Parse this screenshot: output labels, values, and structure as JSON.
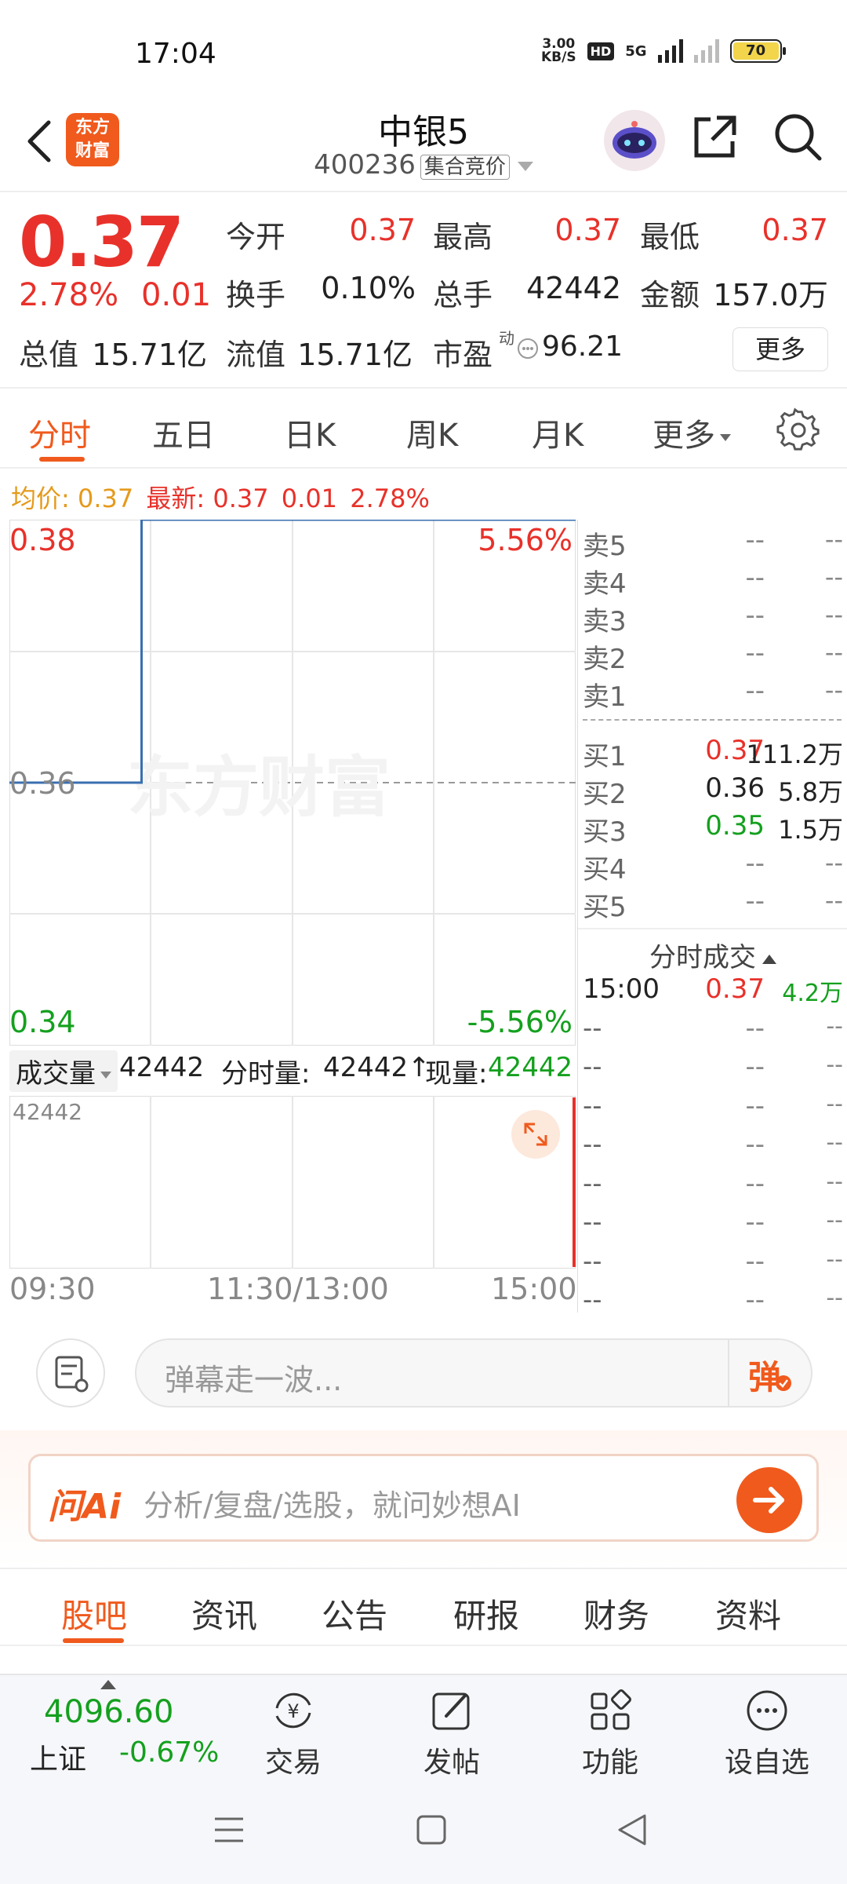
{
  "status_bar": {
    "time": "17:04",
    "net_speed_value": "3.00",
    "net_speed_unit": "KB/S",
    "hd_badge": "HD",
    "network": "5G",
    "battery": "70"
  },
  "header": {
    "logo_line1": "东方",
    "logo_line2": "财富",
    "stock_name": "中银5",
    "stock_code": "400236",
    "auction_tag": "集合竞价"
  },
  "quote": {
    "price": "0.37",
    "change_pct": "2.78%",
    "change_amt": "0.01",
    "open_label": "今开",
    "open": "0.37",
    "high_label": "最高",
    "high": "0.37",
    "low_label": "最低",
    "low": "0.37",
    "turnover_label": "换手",
    "turnover": "0.10%",
    "volume_label": "总手",
    "volume": "42442",
    "amount_label": "金额",
    "amount": "157.0万",
    "mktcap_label": "总值",
    "mktcap": "15.71亿",
    "float_label": "流值",
    "float_cap": "15.71亿",
    "pe_label": "市盈",
    "pe_sup": "动",
    "pe": "96.21",
    "more_button": "更多"
  },
  "chart_tabs": {
    "items": [
      "分时",
      "五日",
      "日K",
      "周K",
      "月K",
      "更多"
    ],
    "active": "分时"
  },
  "info_line": {
    "avg_label": "均价:",
    "avg": "0.37",
    "latest_label": "最新:",
    "latest": "0.37",
    "chg": "0.01",
    "pct": "2.78%"
  },
  "chart": {
    "y_top": "0.38",
    "y_mid": "0.36",
    "y_bottom": "0.34",
    "pct_top": "5.56%",
    "pct_bottom": "-5.56%",
    "watermark": "东方财富",
    "x_start": "09:30",
    "x_mid": "11:30/13:00",
    "x_end": "15:00",
    "vol_axis_max": "42442"
  },
  "chart_data": {
    "type": "line",
    "series": [
      {
        "values": [
          0.36,
          0.36,
          0.38,
          0.38,
          0.38
        ]
      }
    ],
    "x": [
      "09:30",
      "10:25",
      "10:26",
      "13:00",
      "15:00"
    ],
    "ylim": [
      0.34,
      0.38
    ],
    "ylabel": "",
    "xlabel": "",
    "title": ""
  },
  "volume_header": {
    "dropdown": "成交量",
    "total": "42442",
    "fenshi_label": "分时量:",
    "fenshi_value": "42442↑",
    "now_label": "现量:",
    "now_value": "42442"
  },
  "orderbook": {
    "asks": [
      {
        "label": "卖5",
        "price": "--",
        "vol": "--"
      },
      {
        "label": "卖4",
        "price": "--",
        "vol": "--"
      },
      {
        "label": "卖3",
        "price": "--",
        "vol": "--"
      },
      {
        "label": "卖2",
        "price": "--",
        "vol": "--"
      },
      {
        "label": "卖1",
        "price": "--",
        "vol": "--"
      }
    ],
    "bids": [
      {
        "label": "买1",
        "price": "0.37",
        "vol": "111.2万",
        "color": "#e8312a"
      },
      {
        "label": "买2",
        "price": "0.36",
        "vol": "5.8万",
        "color": "#222222"
      },
      {
        "label": "买3",
        "price": "0.35",
        "vol": "1.5万",
        "color": "#14a01e"
      },
      {
        "label": "买4",
        "price": "--",
        "vol": "--",
        "color": "#888888"
      },
      {
        "label": "买5",
        "price": "--",
        "vol": "--",
        "color": "#888888"
      }
    ],
    "trades_title": "分时成交",
    "trades": [
      {
        "time": "15:00",
        "price": "0.37",
        "vol": "4.2万"
      },
      {
        "time": "--",
        "price": "--",
        "vol": "--"
      },
      {
        "time": "--",
        "price": "--",
        "vol": "--"
      },
      {
        "time": "--",
        "price": "--",
        "vol": "--"
      },
      {
        "time": "--",
        "price": "--",
        "vol": "--"
      },
      {
        "time": "--",
        "price": "--",
        "vol": "--"
      },
      {
        "time": "--",
        "price": "--",
        "vol": "--"
      },
      {
        "time": "--",
        "price": "--",
        "vol": "--"
      },
      {
        "time": "--",
        "price": "--",
        "vol": "--"
      }
    ]
  },
  "comment_bar": {
    "placeholder": "弹幕走一波...",
    "danmu_label": "弹"
  },
  "ai_bar": {
    "logo": "问Ai",
    "placeholder": "分析/复盘/选股，就问妙想AI"
  },
  "section_tabs": {
    "items": [
      "股吧",
      "资讯",
      "公告",
      "研报",
      "财务",
      "资料"
    ],
    "active": "股吧"
  },
  "bottom_nav": {
    "index_value": "4096.60",
    "index_name": "上证",
    "index_change": "-0.67%",
    "items": [
      "交易",
      "发帖",
      "功能",
      "设自选"
    ]
  },
  "colors": {
    "up": "#e8312a",
    "down": "#14a01e",
    "accent": "#f05a1d",
    "line": "#3a6fb0",
    "avg": "#e59a1c"
  }
}
